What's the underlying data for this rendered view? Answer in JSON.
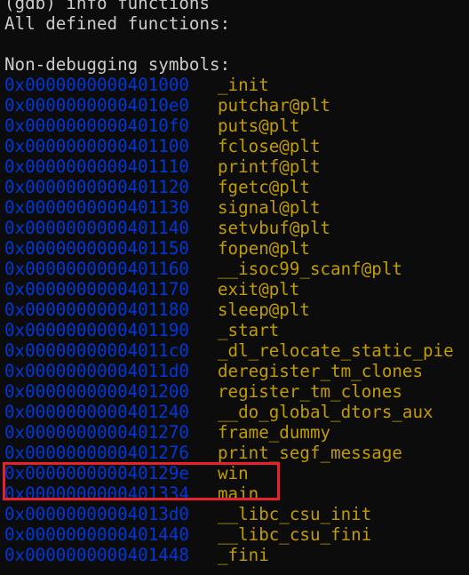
{
  "terminal": {
    "prompt_line": "(gdb) info functions",
    "header_line": "All defined functions:",
    "section_title": "Non-debugging symbols:",
    "symbols": [
      {
        "address": "0x0000000000401000",
        "name": "_init"
      },
      {
        "address": "0x00000000004010e0",
        "name": "putchar@plt"
      },
      {
        "address": "0x00000000004010f0",
        "name": "puts@plt"
      },
      {
        "address": "0x0000000000401100",
        "name": "fclose@plt"
      },
      {
        "address": "0x0000000000401110",
        "name": "printf@plt"
      },
      {
        "address": "0x0000000000401120",
        "name": "fgetc@plt"
      },
      {
        "address": "0x0000000000401130",
        "name": "signal@plt"
      },
      {
        "address": "0x0000000000401140",
        "name": "setvbuf@plt"
      },
      {
        "address": "0x0000000000401150",
        "name": "fopen@plt"
      },
      {
        "address": "0x0000000000401160",
        "name": "__isoc99_scanf@plt"
      },
      {
        "address": "0x0000000000401170",
        "name": "exit@plt"
      },
      {
        "address": "0x0000000000401180",
        "name": "sleep@plt"
      },
      {
        "address": "0x0000000000401190",
        "name": "_start"
      },
      {
        "address": "0x00000000004011c0",
        "name": "_dl_relocate_static_pie"
      },
      {
        "address": "0x00000000004011d0",
        "name": "deregister_tm_clones"
      },
      {
        "address": "0x0000000000401200",
        "name": "register_tm_clones"
      },
      {
        "address": "0x0000000000401240",
        "name": "__do_global_dtors_aux"
      },
      {
        "address": "0x0000000000401270",
        "name": "frame_dummy"
      },
      {
        "address": "0x0000000000401276",
        "name": "print_segf_message"
      },
      {
        "address": "0x000000000040129e",
        "name": "win"
      },
      {
        "address": "0x0000000000401334",
        "name": "main"
      },
      {
        "address": "0x00000000004013d0",
        "name": "__libc_csu_init"
      },
      {
        "address": "0x0000000000401440",
        "name": "__libc_csu_fini"
      },
      {
        "address": "0x0000000000401448",
        "name": "_fini"
      }
    ]
  },
  "colors": {
    "background": "#0c0c0c",
    "text": "#cccccc",
    "address": "#0037da",
    "symbol_name": "#c19c00",
    "highlight_border": "#e8212b"
  },
  "highlight": {
    "target_symbol": "win"
  }
}
